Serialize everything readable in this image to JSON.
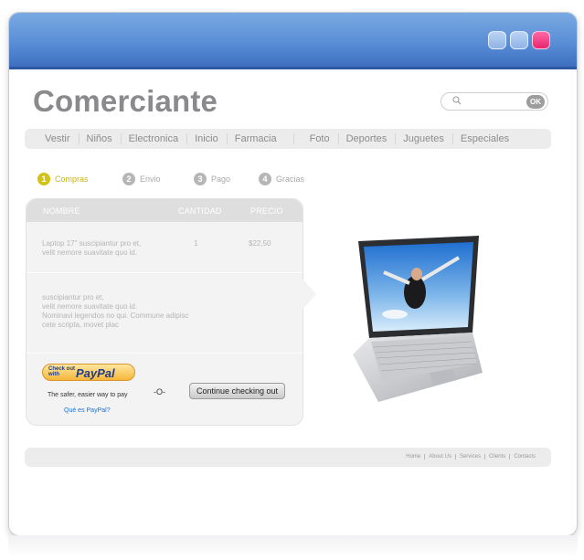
{
  "brand": {
    "title": "Comerciante"
  },
  "search": {
    "placeholder": "",
    "ok_label": "OK"
  },
  "nav": {
    "items": [
      {
        "label": "Vestir"
      },
      {
        "label": "Niños"
      },
      {
        "label": "Electronica"
      },
      {
        "label": "Inicio"
      },
      {
        "label": "Farmacia"
      },
      {
        "label": "Foto"
      },
      {
        "label": "Deportes"
      },
      {
        "label": "Juguetes"
      },
      {
        "label": "Especiales"
      }
    ]
  },
  "steps": [
    {
      "num": "1",
      "label": "Compras",
      "active": true
    },
    {
      "num": "2",
      "label": "Envio",
      "active": false
    },
    {
      "num": "3",
      "label": "Pago",
      "active": false
    },
    {
      "num": "4",
      "label": "Gracias",
      "active": false
    }
  ],
  "cart": {
    "headers": {
      "name": "NOMBRE",
      "qty": "CANTIDAD",
      "price": "PRECIO"
    },
    "item": {
      "description": "Laptop 17\" suscipiantur pro et,\nvelit nemore suavitate quo id.",
      "quantity": "1",
      "price": "$22,50"
    },
    "note": "suscipiantur pro et,\nvelit nemore suavitate quo id.\nNominavi legendos no qui. Commune adipisc\ncete scripta, movet plac"
  },
  "paypal": {
    "small_text": "Check out\nwith",
    "brand_text": "PayPal",
    "tagline": "The safer, easier way to pay",
    "link": "Qué es PayPal?"
  },
  "checkout": {
    "or_label": "-O-",
    "continue_label": "Continue checking out"
  },
  "footer": {
    "links": [
      {
        "label": "Home"
      },
      {
        "label": "About Us"
      },
      {
        "label": "Services"
      },
      {
        "label": "Clients"
      },
      {
        "label": "Contacts"
      }
    ]
  },
  "colors": {
    "titlebar": "#5a8fd6",
    "accent": "#d3c217",
    "close": "#e8246f",
    "link": "#1d6fd6"
  },
  "icons": {
    "search": "search-icon",
    "laptop": "laptop-image"
  }
}
